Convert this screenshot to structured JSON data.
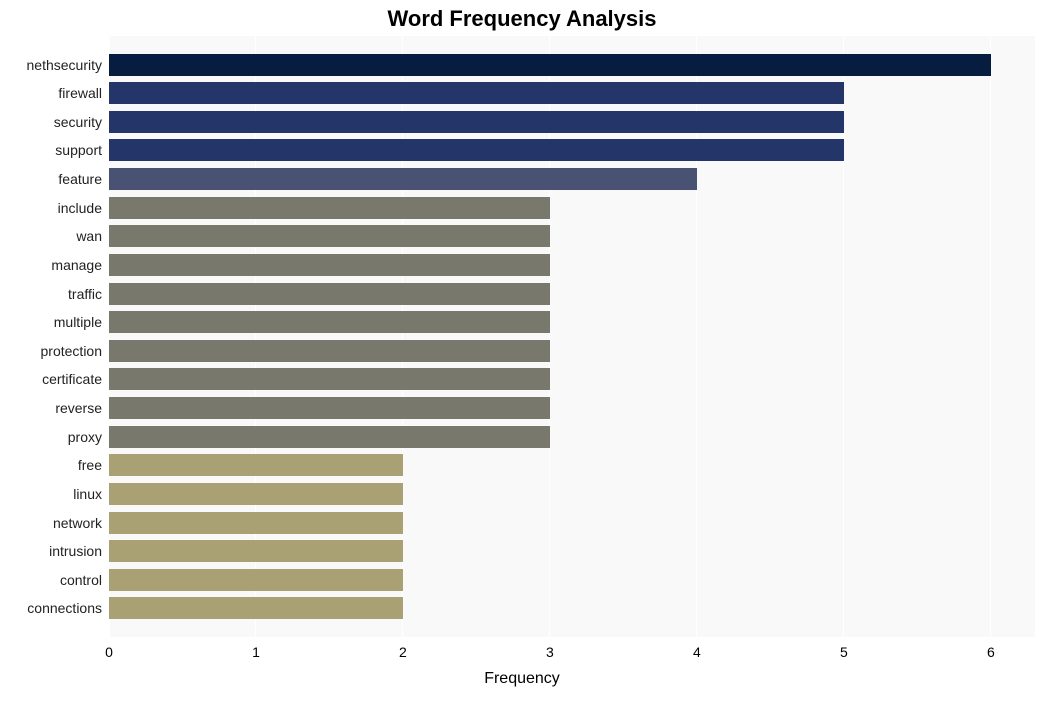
{
  "chart_data": {
    "type": "bar",
    "orientation": "horizontal",
    "title": "Word Frequency Analysis",
    "xlabel": "Frequency",
    "ylabel": "",
    "xlim": [
      0,
      6.3
    ],
    "x_ticks": [
      0,
      1,
      2,
      3,
      4,
      5,
      6
    ],
    "categories": [
      "nethsecurity",
      "firewall",
      "security",
      "support",
      "feature",
      "include",
      "wan",
      "manage",
      "traffic",
      "multiple",
      "protection",
      "certificate",
      "reverse",
      "proxy",
      "free",
      "linux",
      "network",
      "intrusion",
      "control",
      "connections"
    ],
    "values": [
      6,
      5,
      5,
      5,
      4,
      3,
      3,
      3,
      3,
      3,
      3,
      3,
      3,
      3,
      2,
      2,
      2,
      2,
      2,
      2
    ],
    "colors": [
      "#061d3f",
      "#243669",
      "#243669",
      "#243669",
      "#4a5273",
      "#79786c",
      "#79786c",
      "#79786c",
      "#79786c",
      "#79786c",
      "#79786c",
      "#79786c",
      "#79786c",
      "#79786c",
      "#a9a173",
      "#a9a173",
      "#a9a173",
      "#a9a173",
      "#a9a173",
      "#a9a173"
    ]
  }
}
